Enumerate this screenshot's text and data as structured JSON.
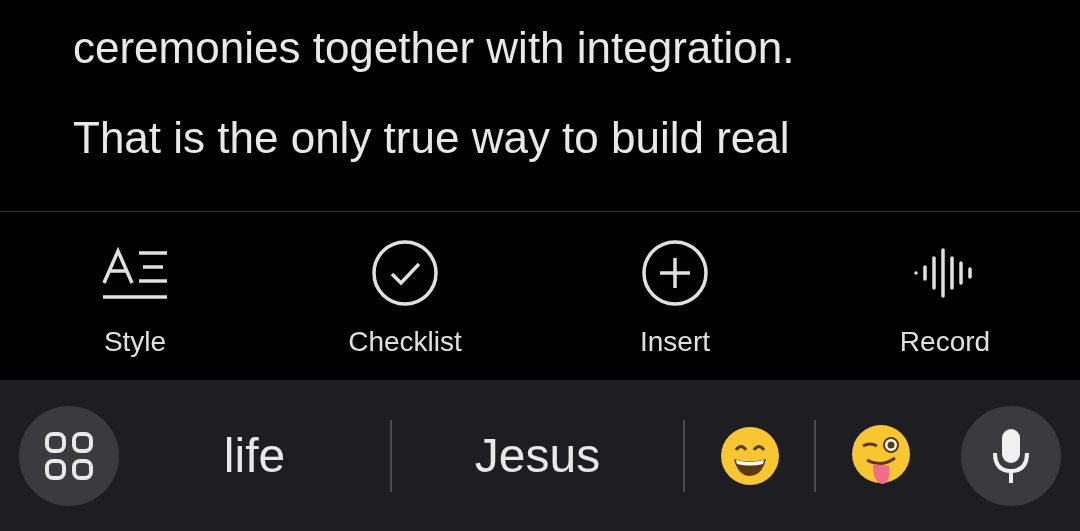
{
  "note_lines": [
    "ceremonies together with integration.",
    "That is the only true way to build real"
  ],
  "toolbar": [
    {
      "kind": "style",
      "label": "Style"
    },
    {
      "kind": "checklist",
      "label": "Checklist"
    },
    {
      "kind": "insert",
      "label": "Insert"
    },
    {
      "kind": "record",
      "label": "Record"
    }
  ],
  "suggestions": [
    {
      "kind": "word",
      "text": "life"
    },
    {
      "kind": "word",
      "text": "Jesus"
    },
    {
      "kind": "grin"
    },
    {
      "kind": "wink"
    }
  ]
}
